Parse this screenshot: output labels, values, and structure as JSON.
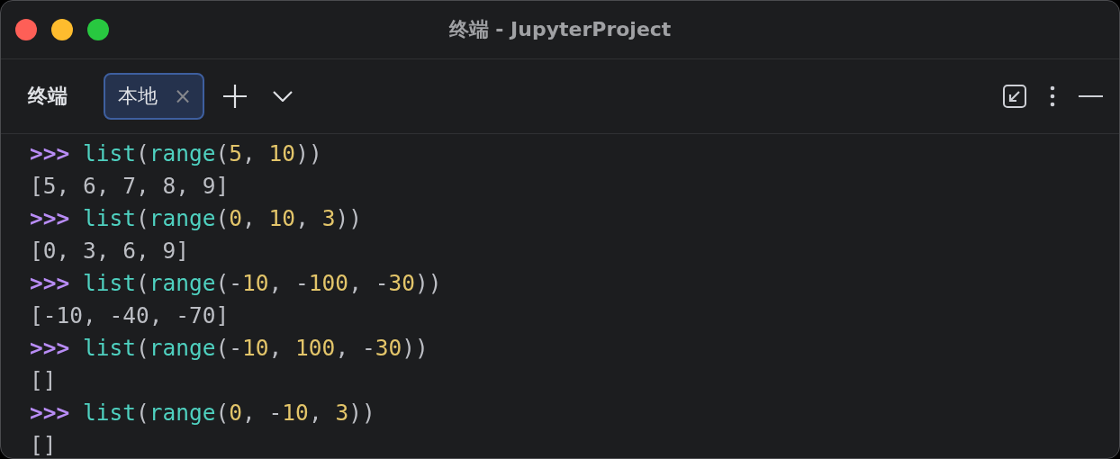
{
  "window": {
    "title": "终端 - JupyterProject"
  },
  "toolbar": {
    "title": "终端",
    "tabs": [
      {
        "label": "本地",
        "selected": true,
        "close": "×"
      }
    ]
  },
  "lines": [
    {
      "tokens": [
        {
          "text": ">>> ",
          "kind": "prompt"
        },
        {
          "text": "list",
          "kind": "name"
        },
        {
          "text": "(",
          "kind": "punct"
        },
        {
          "text": "range",
          "kind": "name"
        },
        {
          "text": "(",
          "kind": "punct"
        },
        {
          "text": "5",
          "kind": "number"
        },
        {
          "text": ", ",
          "kind": "punct"
        },
        {
          "text": "10",
          "kind": "number"
        },
        {
          "text": "))",
          "kind": "punct"
        }
      ]
    },
    {
      "tokens": [
        {
          "text": "[5, 6, 7, 8, 9]",
          "kind": "output"
        }
      ]
    },
    {
      "tokens": [
        {
          "text": ">>> ",
          "kind": "prompt"
        },
        {
          "text": "list",
          "kind": "name"
        },
        {
          "text": "(",
          "kind": "punct"
        },
        {
          "text": "range",
          "kind": "name"
        },
        {
          "text": "(",
          "kind": "punct"
        },
        {
          "text": "0",
          "kind": "number"
        },
        {
          "text": ", ",
          "kind": "punct"
        },
        {
          "text": "10",
          "kind": "number"
        },
        {
          "text": ", ",
          "kind": "punct"
        },
        {
          "text": "3",
          "kind": "number"
        },
        {
          "text": "))",
          "kind": "punct"
        }
      ]
    },
    {
      "tokens": [
        {
          "text": "[0, 3, 6, 9]",
          "kind": "output"
        }
      ]
    },
    {
      "tokens": [
        {
          "text": ">>> ",
          "kind": "prompt"
        },
        {
          "text": "list",
          "kind": "name"
        },
        {
          "text": "(",
          "kind": "punct"
        },
        {
          "text": "range",
          "kind": "name"
        },
        {
          "text": "(-",
          "kind": "punct"
        },
        {
          "text": "10",
          "kind": "number"
        },
        {
          "text": ", -",
          "kind": "punct"
        },
        {
          "text": "100",
          "kind": "number"
        },
        {
          "text": ", -",
          "kind": "punct"
        },
        {
          "text": "30",
          "kind": "number"
        },
        {
          "text": "))",
          "kind": "punct"
        }
      ]
    },
    {
      "tokens": [
        {
          "text": "[-10, -40, -70]",
          "kind": "output"
        }
      ]
    },
    {
      "tokens": [
        {
          "text": ">>> ",
          "kind": "prompt"
        },
        {
          "text": "list",
          "kind": "name"
        },
        {
          "text": "(",
          "kind": "punct"
        },
        {
          "text": "range",
          "kind": "name"
        },
        {
          "text": "(-",
          "kind": "punct"
        },
        {
          "text": "10",
          "kind": "number"
        },
        {
          "text": ", ",
          "kind": "punct"
        },
        {
          "text": "100",
          "kind": "number"
        },
        {
          "text": ", -",
          "kind": "punct"
        },
        {
          "text": "30",
          "kind": "number"
        },
        {
          "text": "))",
          "kind": "punct"
        }
      ]
    },
    {
      "tokens": [
        {
          "text": "[]",
          "kind": "output"
        }
      ]
    },
    {
      "tokens": [
        {
          "text": ">>> ",
          "kind": "prompt"
        },
        {
          "text": "list",
          "kind": "name"
        },
        {
          "text": "(",
          "kind": "punct"
        },
        {
          "text": "range",
          "kind": "name"
        },
        {
          "text": "(",
          "kind": "punct"
        },
        {
          "text": "0",
          "kind": "number"
        },
        {
          "text": ", -",
          "kind": "punct"
        },
        {
          "text": "10",
          "kind": "number"
        },
        {
          "text": ", ",
          "kind": "punct"
        },
        {
          "text": "3",
          "kind": "number"
        },
        {
          "text": "))",
          "kind": "punct"
        }
      ]
    },
    {
      "tokens": [
        {
          "text": "[]",
          "kind": "output"
        }
      ]
    }
  ]
}
